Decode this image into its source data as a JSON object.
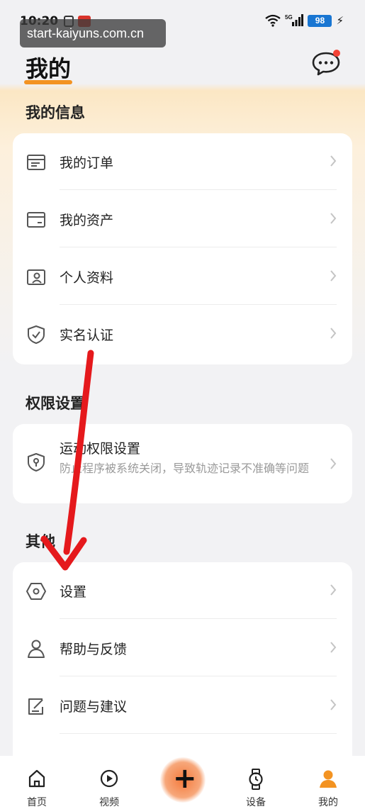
{
  "status_bar": {
    "time": "10:20",
    "network": "5G",
    "battery": "98"
  },
  "watermark": "start-kaiyuns.com.cn",
  "page": {
    "title": "我的"
  },
  "sections": {
    "info": {
      "heading": "我的信息",
      "items": [
        {
          "label": "我的订单",
          "icon": "order-list-icon"
        },
        {
          "label": "我的资产",
          "icon": "wallet-icon"
        },
        {
          "label": "个人资料",
          "icon": "profile-card-icon"
        },
        {
          "label": "实名认证",
          "icon": "verified-shield-icon"
        }
      ]
    },
    "permissions": {
      "heading": "权限设置",
      "item": {
        "label": "运动权限设置",
        "description": "防止程序被系统关闭，导致轨迹记录不准确等问题",
        "icon": "shield-location-icon"
      }
    },
    "other": {
      "heading": "其他",
      "items": [
        {
          "label": "设置",
          "icon": "settings-hexagon-icon"
        },
        {
          "label": "帮助与反馈",
          "icon": "help-person-icon"
        },
        {
          "label": "问题与建议",
          "icon": "edit-note-icon"
        }
      ]
    }
  },
  "bottom_nav": {
    "items": [
      {
        "label": "首页",
        "icon": "home-icon"
      },
      {
        "label": "视频",
        "icon": "play-icon"
      },
      {
        "label": "设备",
        "icon": "watch-icon"
      },
      {
        "label": "我的",
        "icon": "user-icon"
      }
    ],
    "add": {
      "glyph": "+"
    }
  },
  "colors": {
    "accent": "#f39322",
    "arrow": "#e5191c",
    "notification_dot": "#f44336"
  }
}
